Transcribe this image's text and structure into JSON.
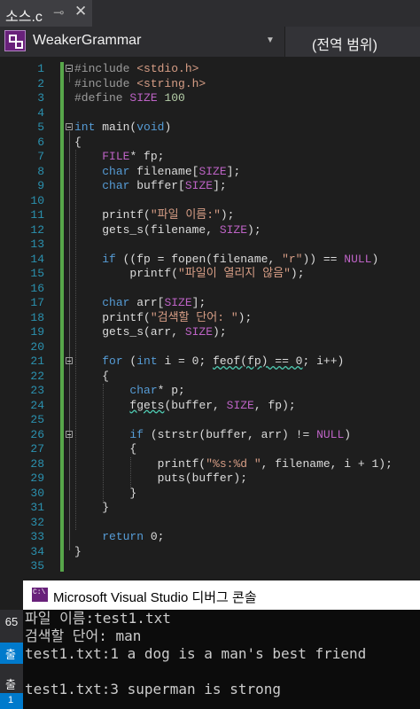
{
  "tab": {
    "title": "소스.c",
    "pin_icon": "pin-icon",
    "close_icon": "close-icon"
  },
  "navbar": {
    "project": "WeakerGrammar",
    "scope": "(전역 범위)"
  },
  "editor": {
    "lines": [
      {
        "n": "1",
        "fold": true,
        "tokens": [
          [
            "pp",
            "#include "
          ],
          [
            "str",
            "<stdio.h>"
          ]
        ]
      },
      {
        "n": "2",
        "tokens": [
          [
            "pp",
            "#include "
          ],
          [
            "str",
            "<string.h>"
          ]
        ]
      },
      {
        "n": "3",
        "tokens": [
          [
            "pp",
            "#define "
          ],
          [
            "mac",
            "SIZE"
          ],
          [
            "t",
            " "
          ],
          [
            "num",
            "100"
          ]
        ]
      },
      {
        "n": "4",
        "tokens": []
      },
      {
        "n": "5",
        "fold": true,
        "tokens": [
          [
            "kw",
            "int"
          ],
          [
            "t",
            " main("
          ],
          [
            "kw",
            "void"
          ],
          [
            "t",
            ")"
          ]
        ]
      },
      {
        "n": "6",
        "tokens": [
          [
            "t",
            "{"
          ]
        ]
      },
      {
        "n": "7",
        "tokens": [
          [
            "t",
            "    "
          ],
          [
            "mac",
            "FILE"
          ],
          [
            "t",
            "* fp;"
          ]
        ]
      },
      {
        "n": "8",
        "tokens": [
          [
            "t",
            "    "
          ],
          [
            "kw",
            "char"
          ],
          [
            "t",
            " filename["
          ],
          [
            "mac",
            "SIZE"
          ],
          [
            "t",
            "];"
          ]
        ]
      },
      {
        "n": "9",
        "tokens": [
          [
            "t",
            "    "
          ],
          [
            "kw",
            "char"
          ],
          [
            "t",
            " buffer["
          ],
          [
            "mac",
            "SIZE"
          ],
          [
            "t",
            "];"
          ]
        ]
      },
      {
        "n": "10",
        "tokens": []
      },
      {
        "n": "11",
        "tokens": [
          [
            "t",
            "    printf("
          ],
          [
            "str",
            "\"파일 이름:\""
          ],
          [
            "t",
            ");"
          ]
        ]
      },
      {
        "n": "12",
        "tokens": [
          [
            "t",
            "    gets_s(filename, "
          ],
          [
            "mac",
            "SIZE"
          ],
          [
            "t",
            ");"
          ]
        ]
      },
      {
        "n": "13",
        "tokens": []
      },
      {
        "n": "14",
        "tokens": [
          [
            "t",
            "    "
          ],
          [
            "kw",
            "if"
          ],
          [
            "t",
            " ((fp = fopen(filename, "
          ],
          [
            "str",
            "\"r\""
          ],
          [
            "t",
            ")) == "
          ],
          [
            "mac",
            "NULL"
          ],
          [
            "t",
            ")"
          ]
        ]
      },
      {
        "n": "15",
        "tokens": [
          [
            "t",
            "        printf("
          ],
          [
            "str",
            "\"파일이 열리지 않음\""
          ],
          [
            "t",
            ");"
          ]
        ]
      },
      {
        "n": "16",
        "tokens": []
      },
      {
        "n": "17",
        "tokens": [
          [
            "t",
            "    "
          ],
          [
            "kw",
            "char"
          ],
          [
            "t",
            " arr["
          ],
          [
            "mac",
            "SIZE"
          ],
          [
            "t",
            "];"
          ]
        ]
      },
      {
        "n": "18",
        "tokens": [
          [
            "t",
            "    printf("
          ],
          [
            "str",
            "\"검색할 단어: \""
          ],
          [
            "t",
            ");"
          ]
        ]
      },
      {
        "n": "19",
        "tokens": [
          [
            "t",
            "    gets_s(arr, "
          ],
          [
            "mac",
            "SIZE"
          ],
          [
            "t",
            ");"
          ]
        ]
      },
      {
        "n": "20",
        "tokens": []
      },
      {
        "n": "21",
        "fold": true,
        "tokens": [
          [
            "t",
            "    "
          ],
          [
            "kw",
            "for"
          ],
          [
            "t",
            " ("
          ],
          [
            "kw",
            "int"
          ],
          [
            "t",
            " i = 0; "
          ],
          [
            "sq",
            "feof(fp) == 0"
          ],
          [
            "t",
            "; i++)"
          ]
        ]
      },
      {
        "n": "22",
        "tokens": [
          [
            "t",
            "    {"
          ]
        ]
      },
      {
        "n": "23",
        "tokens": [
          [
            "t",
            "        "
          ],
          [
            "kw",
            "char"
          ],
          [
            "t",
            "* p;"
          ]
        ]
      },
      {
        "n": "24",
        "tokens": [
          [
            "t",
            "        "
          ],
          [
            "sq",
            "fgets"
          ],
          [
            "t",
            "(buffer, "
          ],
          [
            "mac",
            "SIZE"
          ],
          [
            "t",
            ", fp);"
          ]
        ]
      },
      {
        "n": "25",
        "tokens": []
      },
      {
        "n": "26",
        "fold": true,
        "tokens": [
          [
            "t",
            "        "
          ],
          [
            "kw",
            "if"
          ],
          [
            "t",
            " (strstr(buffer, arr) != "
          ],
          [
            "mac",
            "NULL"
          ],
          [
            "t",
            ")"
          ]
        ]
      },
      {
        "n": "27",
        "tokens": [
          [
            "t",
            "        {"
          ]
        ]
      },
      {
        "n": "28",
        "tokens": [
          [
            "t",
            "            printf("
          ],
          [
            "str",
            "\"%s:%d \""
          ],
          [
            "t",
            ", filename, i + 1);"
          ]
        ]
      },
      {
        "n": "29",
        "tokens": [
          [
            "t",
            "            puts(buffer);"
          ]
        ]
      },
      {
        "n": "30",
        "tokens": [
          [
            "t",
            "        }"
          ]
        ]
      },
      {
        "n": "31",
        "tokens": [
          [
            "t",
            "    }"
          ]
        ]
      },
      {
        "n": "32",
        "tokens": []
      },
      {
        "n": "33",
        "tokens": [
          [
            "t",
            "    "
          ],
          [
            "kw",
            "return"
          ],
          [
            "t",
            " 0;"
          ]
        ]
      },
      {
        "n": "34",
        "tokens": [
          [
            "t",
            "}"
          ]
        ]
      },
      {
        "n": "35",
        "tokens": []
      }
    ]
  },
  "console": {
    "title": "Microsoft Visual Studio 디버그 콘솔",
    "icon_text": "C:\\",
    "lines": [
      "파일 이름:test1.txt",
      "검색할 단어: man",
      "test1.txt:1 a dog is a man's best friend",
      "",
      "test1.txt:3 superman is strong"
    ]
  },
  "left_strip": {
    "num": "65",
    "tab1": "출",
    "item2": "출",
    "tab3": "1"
  },
  "colors": {
    "keyword": "#569cd6",
    "string": "#d69d85",
    "macro": "#bd63c5",
    "line_number": "#2b91af",
    "change_bar": "#57a64a"
  }
}
